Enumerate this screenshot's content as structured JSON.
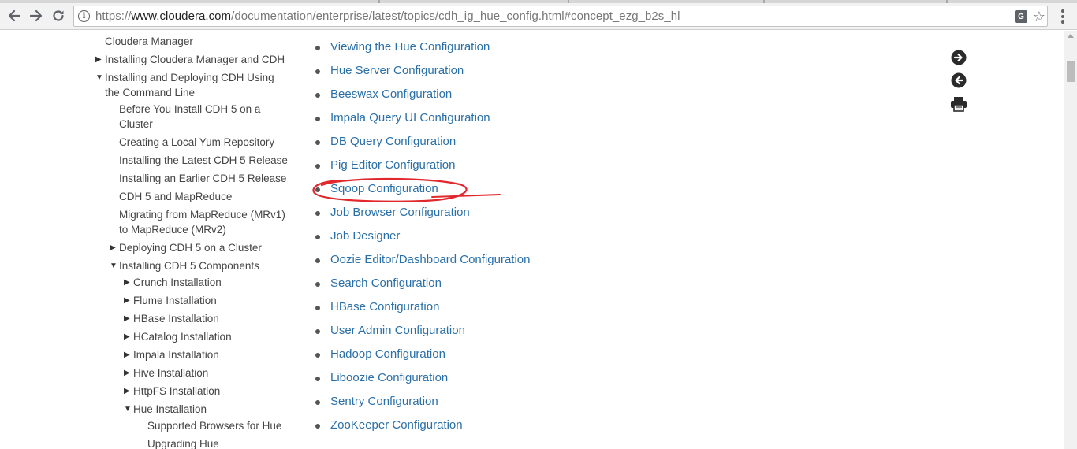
{
  "browser": {
    "url_prefix": "https://",
    "url_host": "www.cloudera.com",
    "url_path": "/documentation/enterprise/latest/topics/cdh_ig_hue_config.html#concept_ezg_b2s_hl",
    "translate_label": "G"
  },
  "sidebar": {
    "items": [
      {
        "label": "Cloudera Manager",
        "expander": ""
      },
      {
        "label": "Installing Cloudera Manager and CDH",
        "expander": "▶"
      },
      {
        "label": "Installing and Deploying CDH Using",
        "expander": "▼"
      },
      {
        "label": "the Command Line",
        "expander": ""
      },
      {
        "label": "Before You Install CDH 5 on a",
        "expander": ""
      },
      {
        "label": "Cluster",
        "expander": ""
      },
      {
        "label": "Creating a Local Yum Repository",
        "expander": ""
      },
      {
        "label": "Installing the Latest CDH 5 Release",
        "expander": ""
      },
      {
        "label": "Installing an Earlier CDH 5 Release",
        "expander": ""
      },
      {
        "label": "CDH 5 and MapReduce",
        "expander": ""
      },
      {
        "label": "Migrating from MapReduce (MRv1)",
        "expander": ""
      },
      {
        "label": "to MapReduce (MRv2)",
        "expander": ""
      },
      {
        "label": "Deploying CDH 5 on a Cluster",
        "expander": "▶"
      },
      {
        "label": "Installing CDH 5 Components",
        "expander": "▼"
      },
      {
        "label": "Crunch Installation",
        "expander": "▶"
      },
      {
        "label": "Flume Installation",
        "expander": "▶"
      },
      {
        "label": "HBase Installation",
        "expander": "▶"
      },
      {
        "label": "HCatalog Installation",
        "expander": "▶"
      },
      {
        "label": "Impala Installation",
        "expander": "▶"
      },
      {
        "label": "Hive Installation",
        "expander": "▶"
      },
      {
        "label": "HttpFS Installation",
        "expander": "▶"
      },
      {
        "label": "Hue Installation",
        "expander": "▼"
      },
      {
        "label": "Supported Browsers for Hue",
        "expander": ""
      },
      {
        "label": "Upgrading Hue",
        "expander": ""
      }
    ]
  },
  "main": {
    "links": [
      "Viewing the Hue Configuration",
      "Hue Server Configuration",
      "Beeswax Configuration",
      "Impala Query UI Configuration",
      "DB Query Configuration",
      "Pig Editor Configuration",
      "Sqoop Configuration",
      "Job Browser Configuration",
      "Job Designer",
      "Oozie Editor/Dashboard Configuration",
      "Search Configuration",
      "HBase Configuration",
      "User Admin Configuration",
      "Hadoop Configuration",
      "Liboozie Configuration",
      "Sentry Configuration",
      "ZooKeeper Configuration"
    ]
  },
  "icons": {
    "next": "arrow-circle-right-icon",
    "prev": "arrow-circle-left-icon",
    "print": "printer-icon"
  },
  "colors": {
    "link": "#2a6fa8",
    "annotation": "#e0282d",
    "nav_text": "#444444"
  }
}
